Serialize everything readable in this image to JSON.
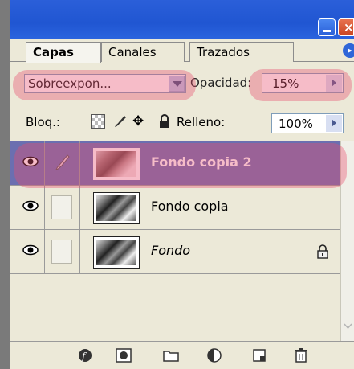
{
  "panel": {
    "tabs": [
      {
        "label": "Capas",
        "active": true
      },
      {
        "label": "Canales",
        "active": false
      },
      {
        "label": "Trazados",
        "active": false
      }
    ]
  },
  "blend": {
    "mode_value": "Sobreexpon...",
    "opacity_label": "Opacidad:",
    "opacity_value": "15%"
  },
  "lock": {
    "label": "Bloq.:",
    "fill_label": "Relleno:",
    "fill_value": "100%"
  },
  "layers": [
    {
      "name": "Fondo copia 2",
      "selected": true,
      "visible": true
    },
    {
      "name": "Fondo copia",
      "selected": false,
      "visible": true
    },
    {
      "name": "Fondo",
      "selected": false,
      "visible": true,
      "locked": true,
      "italic": true
    }
  ],
  "colors": {
    "titlebar": "#2056d2",
    "selected_layer": "#6b6fb0",
    "highlight": "#e8506e",
    "panel_bg": "#ece9d8"
  },
  "icons": [
    "minimize-icon",
    "close-icon",
    "panel-menu-icon",
    "chevron-down-icon",
    "triangle-right-icon",
    "lock-transparency-icon",
    "lock-brush-icon",
    "lock-move-icon",
    "lock-all-icon",
    "eye-icon",
    "brush-icon",
    "layer-lock-icon",
    "layer-style-icon",
    "layer-mask-icon",
    "new-group-icon",
    "adjustment-layer-icon",
    "new-layer-icon",
    "trash-icon"
  ]
}
